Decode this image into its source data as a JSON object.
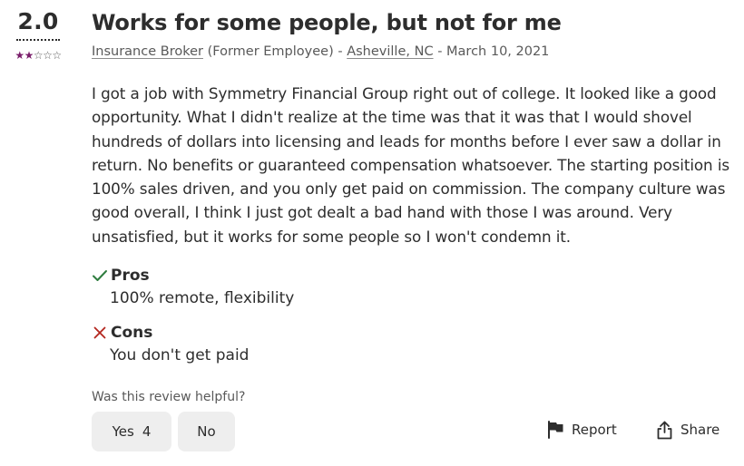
{
  "review": {
    "rating": "2.0",
    "stars_filled": 2,
    "stars_total": 5,
    "title": "Works for some people, but not for me",
    "job_title": "Insurance Broker",
    "employment_status": "(Former Employee)",
    "separator_1": "-",
    "location": "Asheville, NC",
    "separator_2": "-",
    "date": "March 10, 2021",
    "text": "I got a job with Symmetry Financial Group right out of college. It looked like a good opportunity. What I didn't realize at the time was that it was that I would shovel hundreds of dollars into licensing and leads for months before I ever saw a dollar in return. No benefits or guaranteed compensation whatsoever. The starting position is 100% sales driven, and you only get paid on commission. The company culture was good overall, I think I just got dealt a bad hand with those I was around. Very unsatisfied, but it works for some people so I won't condemn it."
  },
  "pros": {
    "heading": "Pros",
    "text": "100% remote, flexibility",
    "icon": "check-icon"
  },
  "cons": {
    "heading": "Cons",
    "text": "You don't get paid",
    "icon": "x-icon"
  },
  "helpful": {
    "question": "Was this review helpful?",
    "yes_label": "Yes",
    "yes_count": "4",
    "no_label": "No"
  },
  "actions": {
    "report_label": "Report",
    "report_icon": "flag-icon",
    "share_label": "Share",
    "share_icon": "share-icon"
  },
  "colors": {
    "star": "#7a1e6b",
    "check": "#2f7d3f",
    "cross": "#b3261e",
    "text": "#2d2d2d",
    "muted": "#595959",
    "button_bg": "#eeeeee"
  }
}
